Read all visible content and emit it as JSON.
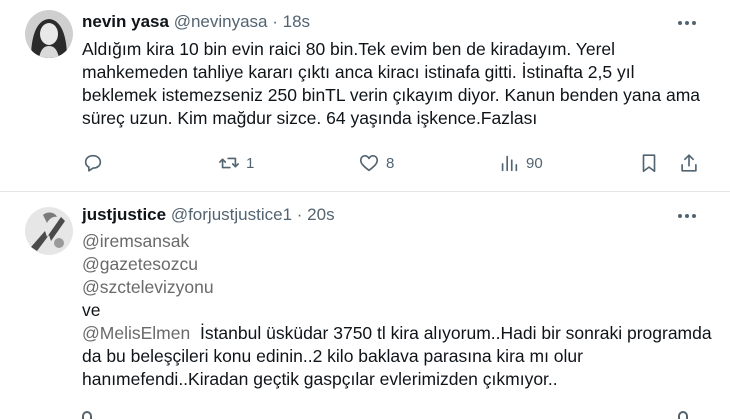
{
  "tweets": [
    {
      "name": "nevin yasa",
      "handle": "@nevinyasa",
      "dot": "·",
      "time": "18s",
      "text": "Aldığım kira 10 bin evin raici 80 bin.Tek evim ben de kiradayım. Yerel mahkemeden tahliye kararı çıktı anca kiracı istinafa gitti. İstinafta 2,5 yıl beklemek istemezseniz 250 binTL verin çıkayım diyor. Kanun benden yana ama süreç uzun. Kim mağdur sizce. 64 yaşında işkence.Fazlası",
      "actions": {
        "reply_count": "",
        "retweet_count": "1",
        "like_count": "8",
        "views_count": "90"
      }
    },
    {
      "name": "justjustice",
      "handle": "@forjustjustice1",
      "dot": "·",
      "time": "20s",
      "mentions": [
        "@iremsansak",
        "@gazetesozcu",
        "@szctelevizyonu"
      ],
      "connector": "ve",
      "last_mention": "@MelisElmen",
      "text": "İstanbul üsküdar 3750 tl kira alıyorum..Hadi bir sonraki programda da bu beleşçileri konu edinin..2 kilo baklava parasına kira mı olur hanımefendi..Kiradan geçtik gaspçılar evlerimizden çıkmıyor.."
    }
  ],
  "icons": {
    "reply": "reply-icon",
    "retweet": "retweet-icon",
    "like": "heart-icon",
    "views": "views-icon",
    "bookmark": "bookmark-icon",
    "share": "share-icon",
    "more": "more-icon"
  }
}
